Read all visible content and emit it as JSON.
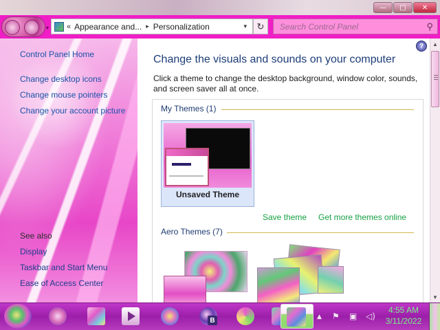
{
  "window": {
    "minimize_label": "—",
    "maximize_label": "□",
    "close_label": "✕"
  },
  "nav": {
    "back_icon": "back-arrow-icon",
    "forward_icon": "forward-arrow-icon",
    "breadcrumb_prefix": "«",
    "breadcrumbs": [
      "Appearance and...",
      "Personalization"
    ],
    "breadcrumb_separator": "▸",
    "dropdown": "▾",
    "refresh_glyph": "↻",
    "search_placeholder": "Search Control Panel",
    "search_glyph": "⚲"
  },
  "sidebar": {
    "home": "Control Panel Home",
    "links": [
      "Change desktop icons",
      "Change mouse pointers",
      "Change your account picture"
    ],
    "see_also_title": "See also",
    "see_also": [
      "Display",
      "Taskbar and Start Menu",
      "Ease of Access Center"
    ]
  },
  "main": {
    "help_glyph": "?",
    "title": "Change the visuals and sounds on your computer",
    "description": "Click a theme to change the desktop background, window color, sounds, and screen saver all at once.",
    "my_themes_header": "My Themes (1)",
    "unsaved_theme_label": "Unsaved Theme",
    "save_theme_link": "Save theme",
    "get_more_link": "Get more themes online",
    "aero_themes_header": "Aero Themes (7)"
  },
  "scrollbar": {
    "up": "▲",
    "down": "▼"
  },
  "taskbar": {
    "tray_arrow": "▲",
    "tray_flag": "⚑",
    "tray_network": "▣",
    "tray_volume": "◁)",
    "time": "4:55 AM",
    "date": "3/11/2022",
    "app_badge": "B"
  },
  "colors": {
    "nav_background": "#f01ec6",
    "link_blue": "#1a52a8",
    "link_green": "#16a042",
    "title_blue": "#1d3d78",
    "taskbar": "#9b1fa9",
    "clock_green": "#7df08a",
    "group_line": "#d2b74d"
  }
}
